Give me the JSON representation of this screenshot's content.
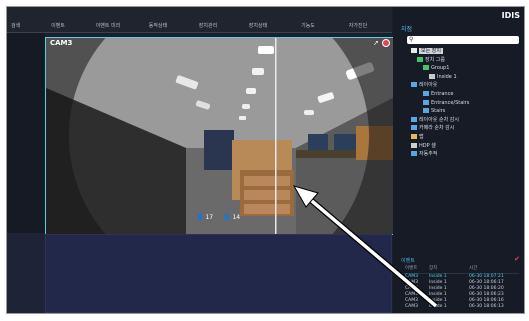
{
  "tabs": [
    "검색",
    "이벤트",
    "이벤트 미리",
    "동작상태",
    "장치관리",
    "장치상태",
    "기능도",
    "자가진단"
  ],
  "camera": {
    "title": "CAM3",
    "count_person": "17",
    "count_other": "14"
  },
  "right_panel": {
    "logo": "IDIS",
    "site_title": "지점",
    "tree": [
      {
        "label": "모든 장치",
        "indent": 0,
        "highlight": true,
        "color": "#e8e8e8"
      },
      {
        "label": "장치 그룹",
        "indent": 1,
        "highlight": false,
        "color": "#49c06a"
      },
      {
        "label": "Group1",
        "indent": 2,
        "highlight": false,
        "color": "#49c06a"
      },
      {
        "label": "Inside 1",
        "indent": 3,
        "highlight": false,
        "color": "#c9c9c9"
      },
      {
        "label": "레이아웃",
        "indent": 0,
        "highlight": false,
        "color": "#5aa7e0"
      },
      {
        "label": "Entrance",
        "indent": 2,
        "highlight": false,
        "color": "#5aa7e0"
      },
      {
        "label": "Entrance/Stairs",
        "indent": 2,
        "highlight": false,
        "color": "#5aa7e0"
      },
      {
        "label": "Stairs",
        "indent": 2,
        "highlight": false,
        "color": "#5aa7e0"
      },
      {
        "label": "레이아웃 순차 감시",
        "indent": 0,
        "highlight": false,
        "color": "#5aa7e0"
      },
      {
        "label": "카메라 순차 감시",
        "indent": 0,
        "highlight": false,
        "color": "#5aa7e0"
      },
      {
        "label": "맵",
        "indent": 0,
        "highlight": false,
        "color": "#e2b95a"
      },
      {
        "label": "HDP 셀",
        "indent": 0,
        "highlight": false,
        "color": "#cfcfcf"
      },
      {
        "label": "자동추적",
        "indent": 0,
        "highlight": false,
        "color": "#5aa7e0"
      }
    ]
  },
  "events": {
    "title": "이벤트",
    "columns": [
      "이벤트",
      "장치",
      "시간"
    ],
    "rows": [
      [
        "CAM3",
        "Inside 1",
        "06-30 18:07:21"
      ],
      [
        "CAM3",
        "Inside 1",
        "06-30 18:06:17"
      ],
      [
        "CAM3",
        "Inside 1",
        "06-30 18:06:20"
      ],
      [
        "CAM3",
        "Inside 1",
        "06-30 18:06:23"
      ],
      [
        "CAM3",
        "Inside 1",
        "06-30 18:06:16"
      ],
      [
        "CAM3",
        "Inside 1",
        "06-30 18:06:13"
      ]
    ]
  },
  "colors": {
    "accent": "#4fd2e6",
    "panel_blue": "#57b4e8",
    "record_red": "#e0465a"
  }
}
